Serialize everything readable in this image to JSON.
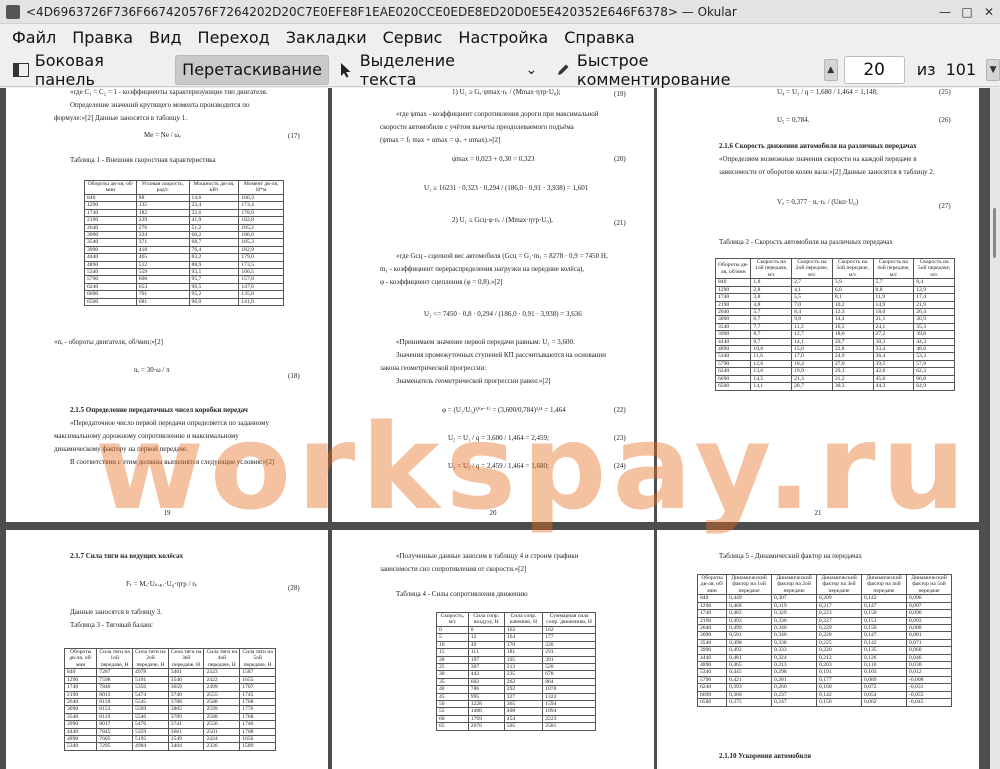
{
  "window": {
    "title": "<4D6963726F736F667420576F7264202D20C7E0EFE8F1EAE020CCE0EDE8ED20D0E5E420352E646F6378> — Okular"
  },
  "menu": [
    "Файл",
    "Правка",
    "Вид",
    "Переход",
    "Закладки",
    "Сервис",
    "Настройка",
    "Справка"
  ],
  "toolbar": {
    "sidebar": "Боковая панель",
    "drag": "Перетаскивание",
    "select_text": "Выделение текста",
    "annotate": "Быстрое комментирование",
    "page_current": "20",
    "page_of": "из",
    "page_total": "101"
  },
  "watermark": "workspay.ru",
  "pages": {
    "p19": {
      "lines": [
        "«где C₁ = C₂ = 1 - коэффициенты характеризующие тип двигателя.",
        "Определение значений крутящего момента производится по",
        "формуле:»[2] Данные заносятся в таблицу 1.",
        "Me = Ne / ωₑ",
        "(17)",
        "Таблица 1 - Внешняя скоростная характеристика",
        "«nₑ - обороты двигателя, об/мин;»[2]",
        "nₑ = 30·ω / π",
        "(18)",
        "2.1.5 Определение передаточных чисел коробки передач",
        "«Передаточное число первой передачи определяется по заданному",
        "максимальному дорожному сопротивлению и максимальному",
        "динамическому фактору на первой передаче.",
        "В соответствии с этим должны выполнятся следующие условия:»[2]",
        "19"
      ],
      "table": {
        "headers": [
          "Обороты дв-ля, об/мин",
          "Угловая скорость, рад/с",
          "Мощность дв-ля, кВт",
          "Момент дв-ля, Н*м"
        ],
        "rows": [
          [
            "840",
            "88",
            "14,6",
            "166,3"
          ],
          [
            "1290",
            "135",
            "23,4",
            "173,4"
          ],
          [
            "1740",
            "182",
            "32,6",
            "178,9"
          ],
          [
            "2190",
            "229",
            "41,9",
            "182,8"
          ],
          [
            "2640",
            "276",
            "51,2",
            "185,2"
          ],
          [
            "3090",
            "324",
            "60,2",
            "186,0"
          ],
          [
            "3540",
            "371",
            "68,7",
            "185,3"
          ],
          [
            "3990",
            "418",
            "76,4",
            "182,9"
          ],
          [
            "4440",
            "465",
            "83,2",
            "179,0"
          ],
          [
            "4890",
            "512",
            "88,9",
            "173,5"
          ],
          [
            "5340",
            "559",
            "93,1",
            "166,5"
          ],
          [
            "5790",
            "606",
            "95,7",
            "157,8"
          ],
          [
            "6240",
            "653",
            "96,5",
            "147,6"
          ],
          [
            "6690",
            "701",
            "95,2",
            "135,8"
          ],
          [
            "6500",
            "681",
            "96,0",
            "141,0"
          ]
        ]
      }
    },
    "p20": {
      "lines": [
        "1) U₁ ≥ Gₐ·ψmax·rₖ / (Mmax·ηтр·U₀);",
        "(19)",
        "«где ψmax - коэффициент сопротивления дороги при максимальной",
        "скорости автомобиля с учётом вычеты преодолеваемого подъёма",
        "(ψmax = fₜ max + αmax = ψᵥ + αmax).»[2]",
        "ψmax = 0,023 + 0,30 = 0,323",
        "(20)",
        "U₁ ≥ 16231 · 0,323 · 0,294 / (186,0 · 0,91 · 3,938) = 1,601",
        "2) U₁ ≤ Gсц·φ·rₖ / (Mmax·ηтр·U₀),",
        "(21)",
        "«где Gсц - сцепной вес автомобиля (Gсц = G₁·m₁ = 8278 · 0,9 = 7450 Н,",
        "m₁ - коэффициент перераспределения нагрузки на передние колёса),",
        "φ - коэффициент сцепления (φ = 0,8).»[2]",
        "U₁ <= 7450 · 0,8 · 0,294 / (186,0 · 0,91 · 3,938) = 3,636",
        "«Принимаем значение первой передачи равным: U₁ = 3,600.",
        "Значения промежуточных ступеней КП рассчитываются на основании",
        "закона геометрической прогрессии:",
        "Знаменатель геометрической прогрессии равен:»[2]",
        "φ = (U₁/U₅)¹/⁽ⁿ⁻¹⁾ = (3,600/0,784)¹/⁴ = 1,464",
        "(22)",
        "U₂ = U₁ / q = 3,600 / 1,464 = 2,459;",
        "(23)",
        "U₃ = U₂ / q = 2,459 / 1,464 = 1,680;",
        "(24)",
        "20"
      ]
    },
    "p21": {
      "lines": [
        "U₄ = U₃ / q = 1,680 / 1,464 = 1,148;",
        "(25)",
        "U₅ = 0,784.",
        "(26)",
        "2.1.6 Скорость движения автомобиля на различных передачах",
        "«Определяем возможные значения скорости на каждой передаче в",
        "зависимости от оборотов колен вала:»[2] Данные заносятся в таблицу 2.",
        "Vₐ = 0,377 · nₑ·rₖ / (Uкп·U₀)",
        "(27)",
        "Таблица 2 - Скорость автомобиля на различных передачах",
        "21"
      ],
      "table": {
        "headers": [
          "Обороты дв-ля, об/мин",
          "Скорость на 1ой передаче, м/с",
          "Скорость на 2ой передаче, м/с",
          "Скорость на 3ой передаче, м/с",
          "Скорость на 4ой передаче, м/с",
          "Скорость на 5ой передаче, м/с"
        ],
        "rows": [
          [
            "840",
            "1,8",
            "2,7",
            "3,9",
            "5,7",
            "8,4"
          ],
          [
            "1290",
            "2,8",
            "4,1",
            "6,0",
            "8,8",
            "12,9"
          ],
          [
            "1740",
            "3,8",
            "5,5",
            "8,1",
            "11,9",
            "17,4"
          ],
          [
            "2190",
            "4,8",
            "7,0",
            "10,2",
            "14,9",
            "21,9"
          ],
          [
            "2640",
            "5,7",
            "8,4",
            "12,3",
            "18,0",
            "26,4"
          ],
          [
            "3090",
            "6,7",
            "9,8",
            "14,4",
            "21,1",
            "30,9"
          ],
          [
            "3540",
            "7,7",
            "11,3",
            "16,5",
            "24,1",
            "35,3"
          ],
          [
            "3990",
            "8,7",
            "12,7",
            "18,6",
            "27,2",
            "39,8"
          ],
          [
            "4440",
            "9,7",
            "14,1",
            "20,7",
            "30,3",
            "44,3"
          ],
          [
            "4890",
            "10,6",
            "15,6",
            "22,8",
            "33,4",
            "48,8"
          ],
          [
            "5340",
            "11,6",
            "17,0",
            "24,9",
            "36,4",
            "53,3"
          ],
          [
            "5790",
            "12,6",
            "18,4",
            "27,0",
            "39,5",
            "57,8"
          ],
          [
            "6240",
            "13,6",
            "19,9",
            "29,1",
            "42,6",
            "62,3"
          ],
          [
            "6690",
            "14,5",
            "21,3",
            "31,2",
            "45,6",
            "66,8"
          ],
          [
            "6500",
            "14,1",
            "20,7",
            "30,3",
            "44,3",
            "64,9"
          ]
        ]
      }
    },
    "p22": {
      "lines": [
        "2.1.7 Сила тяги на ведущих колёсах",
        "Fₜ = Mₑ·Uₖ.ₚ.·U₀·ηтр / rₖ",
        "(28)",
        "Данные заносятся в таблицу 3.",
        "Таблица 3 - Тяговый баланс"
      ],
      "table": {
        "headers": [
          "Обороты дв-ля, об/мин",
          "Сила тяги на 1ой передаче, Н",
          "Сила тяги на 2ой передаче, Н",
          "Сила тяги на 3ей передаче, Н",
          "Сила тяги на 4ой передаче, Н",
          "Сила тяги на 5ой передаче, Н"
        ],
        "rows": [
          [
            "840",
            "7287",
            "4978",
            "3401",
            "2323",
            "1587"
          ],
          [
            "1290",
            "7598",
            "5191",
            "3546",
            "2422",
            "1655"
          ],
          [
            "1740",
            "7840",
            "5356",
            "3659",
            "2499",
            "1707"
          ],
          [
            "2190",
            "8013",
            "5474",
            "3740",
            "2555",
            "1745"
          ],
          [
            "2640",
            "8118",
            "5545",
            "3788",
            "2588",
            "1768"
          ],
          [
            "3090",
            "8153",
            "5569",
            "3805",
            "2599",
            "1776"
          ],
          [
            "3540",
            "8119",
            "5546",
            "3789",
            "2588",
            "1768"
          ],
          [
            "3990",
            "8017",
            "5476",
            "3741",
            "2556",
            "1746"
          ],
          [
            "4440",
            "7845",
            "5359",
            "3661",
            "2501",
            "1708"
          ],
          [
            "4890",
            "7605",
            "5195",
            "3549",
            "2424",
            "1656"
          ],
          [
            "5340",
            "7295",
            "4984",
            "3404",
            "2326",
            "1589"
          ]
        ]
      }
    },
    "p23": {
      "lines": [
        "«Полученные данные заносим в таблицу 4 и строим графики",
        "зависимости сил сопротивления от скорости.»[2]",
        "Таблица 4 - Силы сопротивления движению"
      ],
      "table": {
        "headers": [
          "Скорость, м/с",
          "Сила сопр. воздуху, Н",
          "Сила сопр. качению, Н",
          "Суммарная сила сопр. движению, Н"
        ],
        "rows": [
          [
            "0",
            "0",
            "162",
            "162"
          ],
          [
            "5",
            "12",
            "164",
            "177"
          ],
          [
            "10",
            "49",
            "170",
            "220"
          ],
          [
            "15",
            "111",
            "181",
            "291"
          ],
          [
            "20",
            "197",
            "195",
            "391"
          ],
          [
            "25",
            "307",
            "213",
            "520"
          ],
          [
            "30",
            "442",
            "235",
            "678"
          ],
          [
            "35",
            "602",
            "262",
            "864"
          ],
          [
            "40",
            "786",
            "292",
            "1078"
          ],
          [
            "45",
            "995",
            "327",
            "1322"
          ],
          [
            "50",
            "1228",
            "365",
            "1594"
          ],
          [
            "55",
            "1486",
            "408",
            "1894"
          ],
          [
            "60",
            "1769",
            "454",
            "2223"
          ],
          [
            "65",
            "2076",
            "505",
            "2581"
          ]
        ]
      }
    },
    "p24": {
      "lines": [
        "Таблица 5 - Динамический фактор на передачах",
        "2.1.10 Ускорения автомобиля"
      ],
      "table": {
        "headers": [
          "Обороты дв-ля, об/мин",
          "Динамический фактор на 1ой передаче",
          "Динамический фактор на 2ой передаче",
          "Динамический фактор на 3ей передаче",
          "Динамический фактор на 4ой передаче",
          "Динамический фактор на 5ой передаче"
        ],
        "rows": [
          [
            "840",
            "0,449",
            "0,307",
            "0,209",
            "0,142",
            "0,096"
          ],
          [
            "1290",
            "0,468",
            "0,319",
            "0,217",
            "0,147",
            "0,097"
          ],
          [
            "1740",
            "0,483",
            "0,329",
            "0,223",
            "0,150",
            "0,096"
          ],
          [
            "2190",
            "0,493",
            "0,336",
            "0,227",
            "0,151",
            "0,093"
          ],
          [
            "2640",
            "0,499",
            "0,340",
            "0,229",
            "0,150",
            "0,088"
          ],
          [
            "3090",
            "0,501",
            "0,340",
            "0,228",
            "0,147",
            "0,081"
          ],
          [
            "3540",
            "0,498",
            "0,338",
            "0,225",
            "0,142",
            "0,071"
          ],
          [
            "3990",
            "0,492",
            "0,333",
            "0,220",
            "0,135",
            "0,060"
          ],
          [
            "4440",
            "0,481",
            "0,324",
            "0,213",
            "0,126",
            "0,046"
          ],
          [
            "4890",
            "0,465",
            "0,313",
            "0,203",
            "0,116",
            "0,030"
          ],
          [
            "5340",
            "0,445",
            "0,298",
            "0,191",
            "0,103",
            "0,012"
          ],
          [
            "5790",
            "0,421",
            "0,281",
            "0,177",
            "0,089",
            "-0,008"
          ],
          [
            "6240",
            "0,393",
            "0,260",
            "0,160",
            "0,072",
            "-0,031"
          ],
          [
            "6690",
            "0,360",
            "0,237",
            "0,142",
            "0,054",
            "-0,055"
          ],
          [
            "6500",
            "0,375",
            "0,247",
            "0,150",
            "0,062",
            "-0,045"
          ]
        ]
      }
    }
  }
}
